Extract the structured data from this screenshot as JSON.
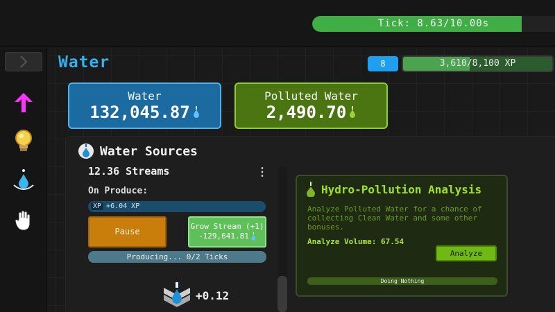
{
  "top": {
    "tick_text": "Tick: 8.63/10.00s",
    "tick_progress": 0.863
  },
  "sidebar": {
    "items": [
      {
        "name": "upgrade-arrow-icon",
        "color": "#ff33ff"
      },
      {
        "name": "lightbulb-icon",
        "color": "#f2c94c"
      },
      {
        "name": "water-drop-ripple-icon",
        "color": "#37b6f0"
      },
      {
        "name": "hand-icon",
        "color": "#ffffff"
      }
    ]
  },
  "header": {
    "title": "Water",
    "level": "8",
    "xp_text": "3,610/8,100 XP",
    "xp_progress": 0.4457
  },
  "resources": {
    "water": {
      "label": "Water",
      "value": "132,045.87"
    },
    "polluted": {
      "label": "Polluted Water",
      "value": "2,490.70"
    }
  },
  "sources": {
    "title": "Water Sources",
    "streams": "12.36 Streams",
    "menu": "⋮",
    "on_produce_label": "On Produce:",
    "xp_badge": "XP",
    "xp_gain": "+6.04 XP",
    "pause_label": "Pause",
    "grow_label": "Grow Stream (+1)",
    "grow_cost": "-129,641.81",
    "producing_text": "Producing... 0/2 Ticks",
    "bottom_value": "+0.12"
  },
  "analysis": {
    "title": "Hydro-Pollution Analysis",
    "description": "Analyze Polluted Water for a chance of collecting Clean Water and some other bonuses.",
    "volume_text": "Analyze Volume: 67.54",
    "analyze_label": "Analyze",
    "status_text": "Doing Nothing"
  },
  "colors": {
    "accent_blue": "#33b1ea",
    "accent_green": "#9fe41e",
    "pause_orange": "#c97d0a"
  }
}
